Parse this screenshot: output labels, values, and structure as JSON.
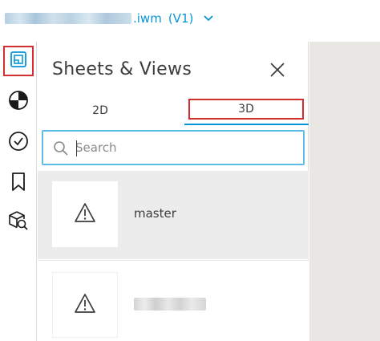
{
  "header": {
    "file_name_suffix": ".iwm",
    "version": "(V1)",
    "accent_color": "#0696d7"
  },
  "rail": {
    "items": [
      {
        "icon": "sheets-views-icon",
        "active": true
      },
      {
        "icon": "model-browser-icon",
        "active": false
      },
      {
        "icon": "issues-check-icon",
        "active": false
      },
      {
        "icon": "bookmark-icon",
        "active": false
      },
      {
        "icon": "search-model-icon",
        "active": false
      }
    ]
  },
  "panel": {
    "title": "Sheets & Views",
    "tabs": [
      {
        "label": "2D",
        "selected": false
      },
      {
        "label": "3D",
        "selected": true
      }
    ],
    "search": {
      "placeholder": "Search",
      "value": ""
    },
    "items": [
      {
        "label": "master",
        "thumbnail_icon": "warning-icon",
        "selected": true
      },
      {
        "label": "",
        "thumbnail_icon": "warning-icon",
        "selected": false
      }
    ]
  },
  "colors": {
    "highlight_red": "#d32f2f",
    "selected_row": "#ececec",
    "viewer_bg": "#e9e7e4"
  }
}
